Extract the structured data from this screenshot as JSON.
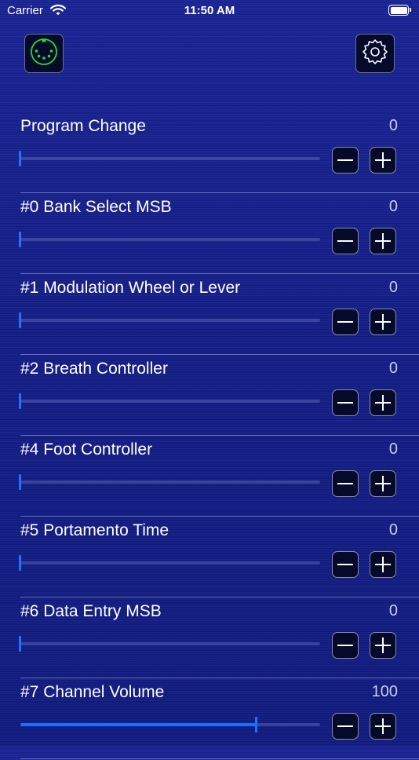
{
  "status_bar": {
    "carrier": "Carrier",
    "time": "11:50 AM"
  },
  "toolbar": {
    "left_icon": "midi-connector-icon",
    "right_icon": "gear-icon"
  },
  "controls": [
    {
      "label": "Program Change",
      "value": "0",
      "fraction": 0
    },
    {
      "label": "#0 Bank Select MSB",
      "value": "0",
      "fraction": 0
    },
    {
      "label": "#1 Modulation Wheel or Lever",
      "value": "0",
      "fraction": 0
    },
    {
      "label": "#2 Breath Controller",
      "value": "0",
      "fraction": 0
    },
    {
      "label": "#4 Foot Controller",
      "value": "0",
      "fraction": 0
    },
    {
      "label": "#5 Portamento Time",
      "value": "0",
      "fraction": 0
    },
    {
      "label": "#6 Data Entry MSB",
      "value": "0",
      "fraction": 0
    },
    {
      "label": "#7 Channel Volume",
      "value": "100",
      "fraction": 0.787
    }
  ],
  "colors": {
    "accent": "#1a6dff",
    "background": "#141e86",
    "midi_icon": "#22dd33"
  }
}
